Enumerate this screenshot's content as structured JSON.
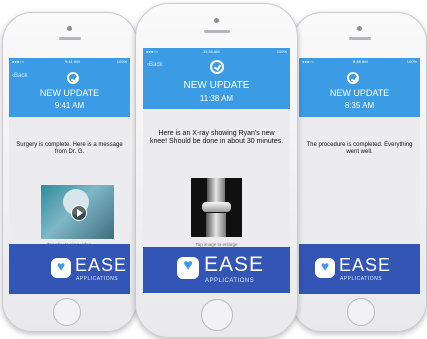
{
  "status": {
    "time_left": "9:41 AM",
    "time_center": "11:38 AM",
    "time_right": "8:48 AM",
    "carrier": "●●●○○",
    "battery": "100%"
  },
  "nav": {
    "back_label": "Back"
  },
  "brand": {
    "name": "EASE",
    "sub": "APPLICATIONS",
    "icon": "heart-monitor-icon",
    "nav_color": "#3b9be5",
    "footer_color": "#3355b5"
  },
  "phones": {
    "left": {
      "title": "NEW UPDATE",
      "time": "9:41 AM",
      "message": "Surgery is complete.  Here is a message from Dr. G.",
      "caption": "Tap play to view video."
    },
    "center": {
      "title": "NEW UPDATE",
      "time": "11:38 AM",
      "message": "Here is an X-ray showing Ryan's new knee!  Should be done in about 30 minutes.",
      "caption": "Tap image to enlarge"
    },
    "right": {
      "title": "NEW UPDATE",
      "time": "8:35 AM",
      "message": "The procedure is completed. Everything went well."
    }
  }
}
